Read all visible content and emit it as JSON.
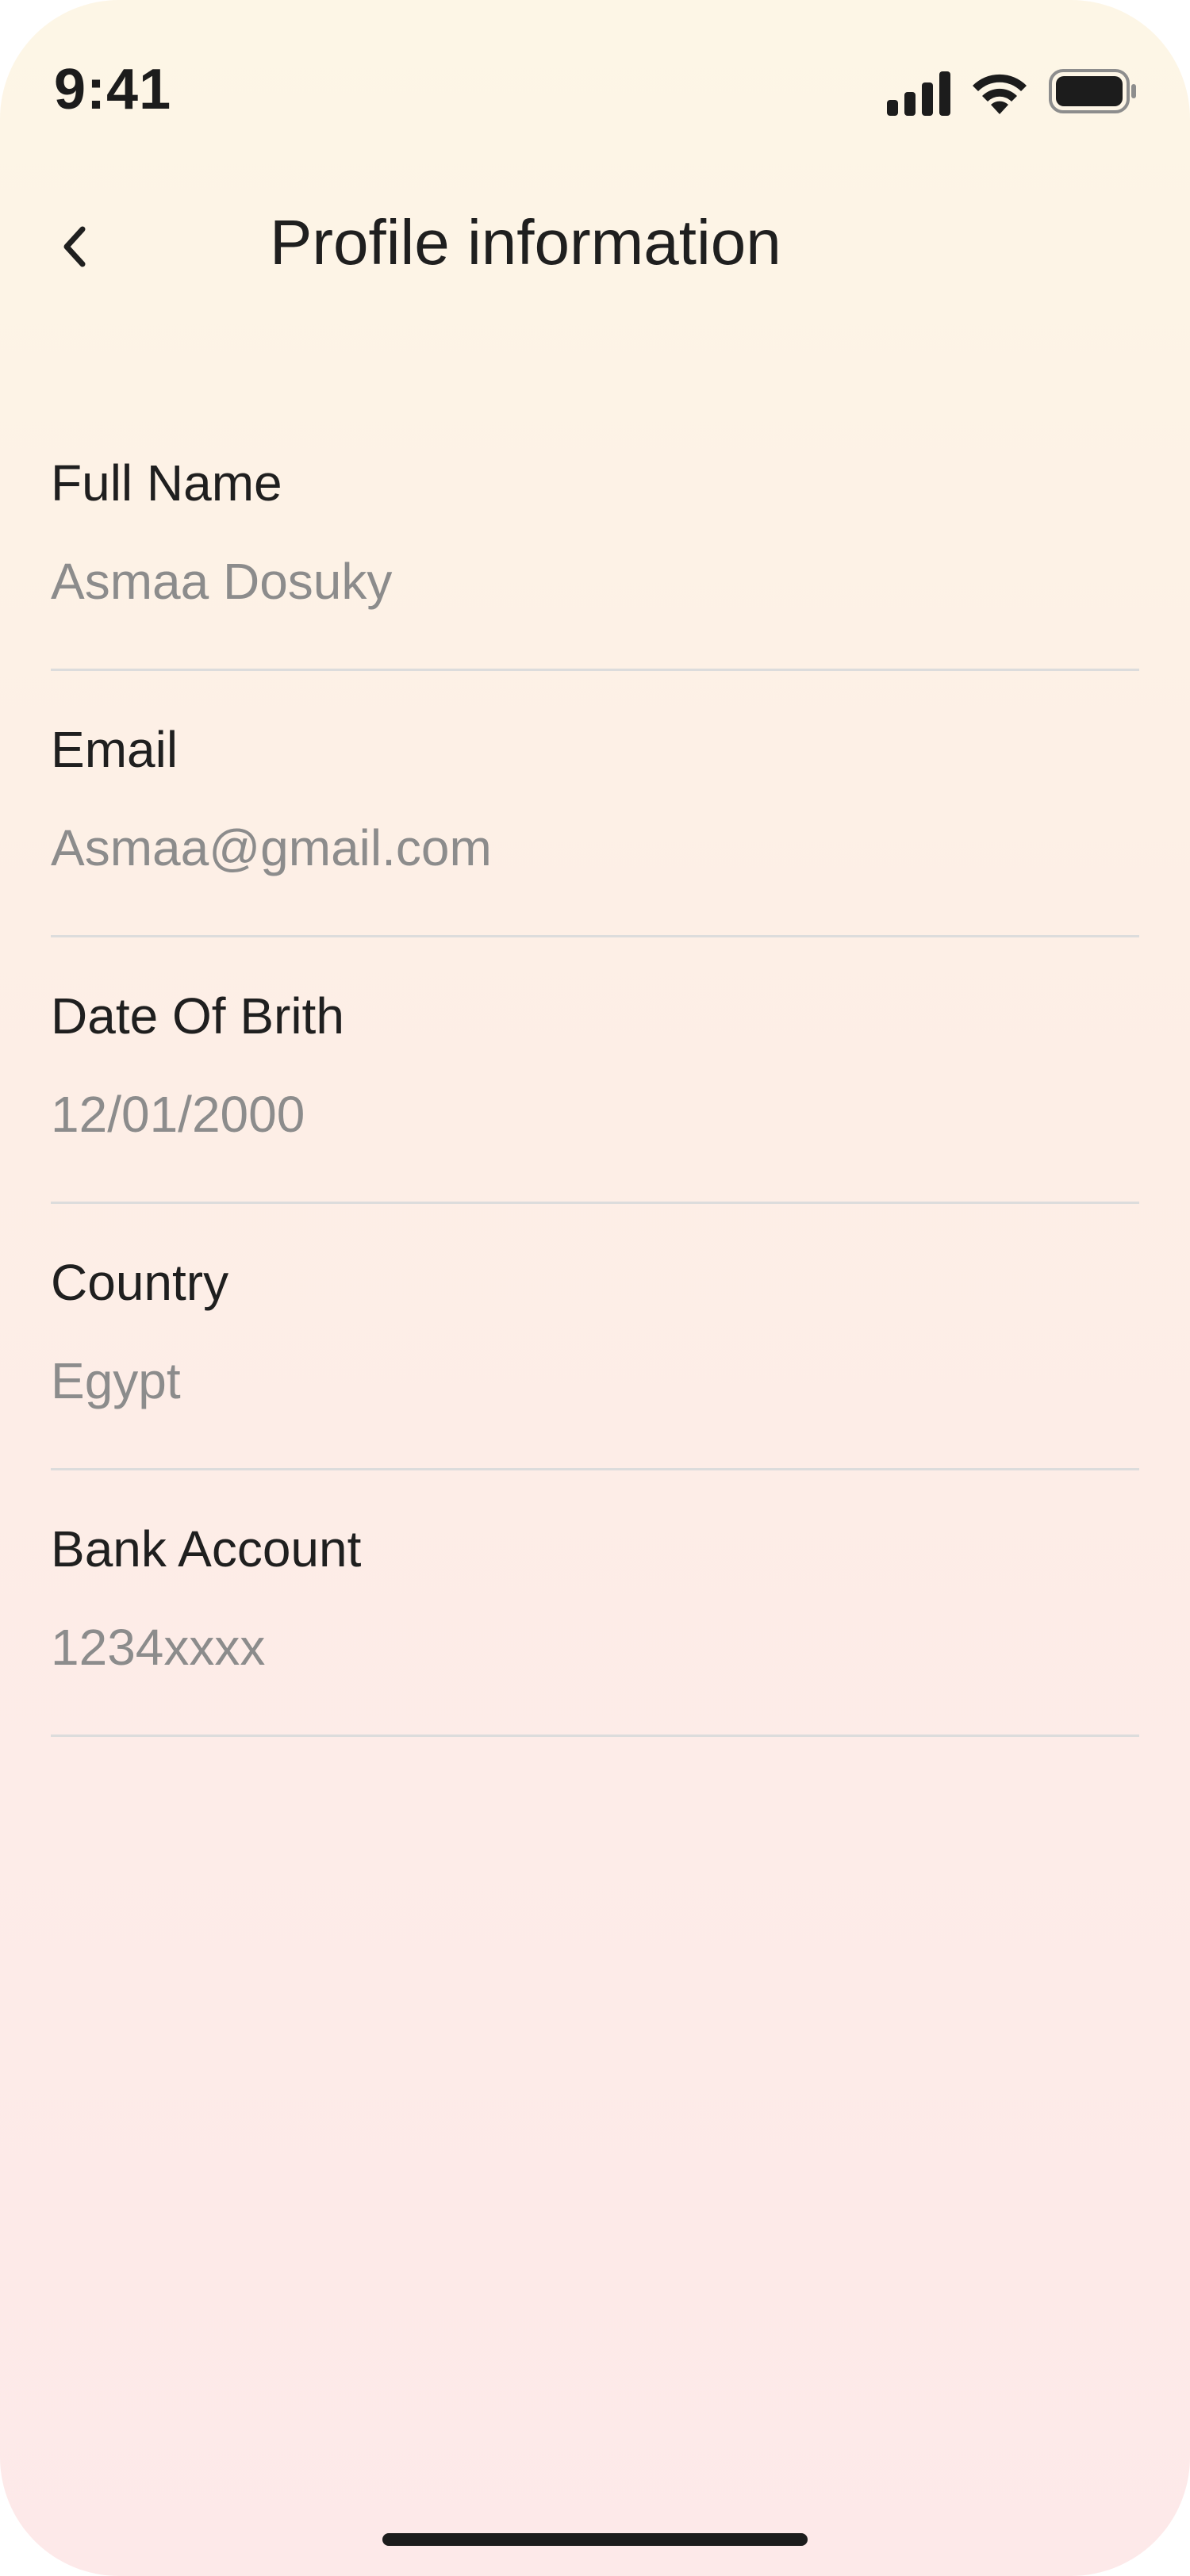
{
  "status_bar": {
    "time": "9:41",
    "icons": [
      "signal-icon",
      "wifi-icon",
      "battery-icon"
    ]
  },
  "header": {
    "back_icon": "chevron-left-icon",
    "title": "Profile information"
  },
  "fields": [
    {
      "label": "Full Name",
      "value": "Asmaa Dosuky"
    },
    {
      "label": "Email",
      "value": "Asmaa@gmail.com"
    },
    {
      "label": "Date Of Brith",
      "value": "12/01/2000"
    },
    {
      "label": "Country",
      "value": "Egypt"
    },
    {
      "label": "Bank Account",
      "value": "1234xxxx"
    }
  ],
  "colors": {
    "background_top": "#fdf6e6",
    "background_bottom": "#fde9e9",
    "label_text": "#1f1f1f",
    "value_text": "#8c8c8c",
    "divider": "#dcdcdc"
  }
}
